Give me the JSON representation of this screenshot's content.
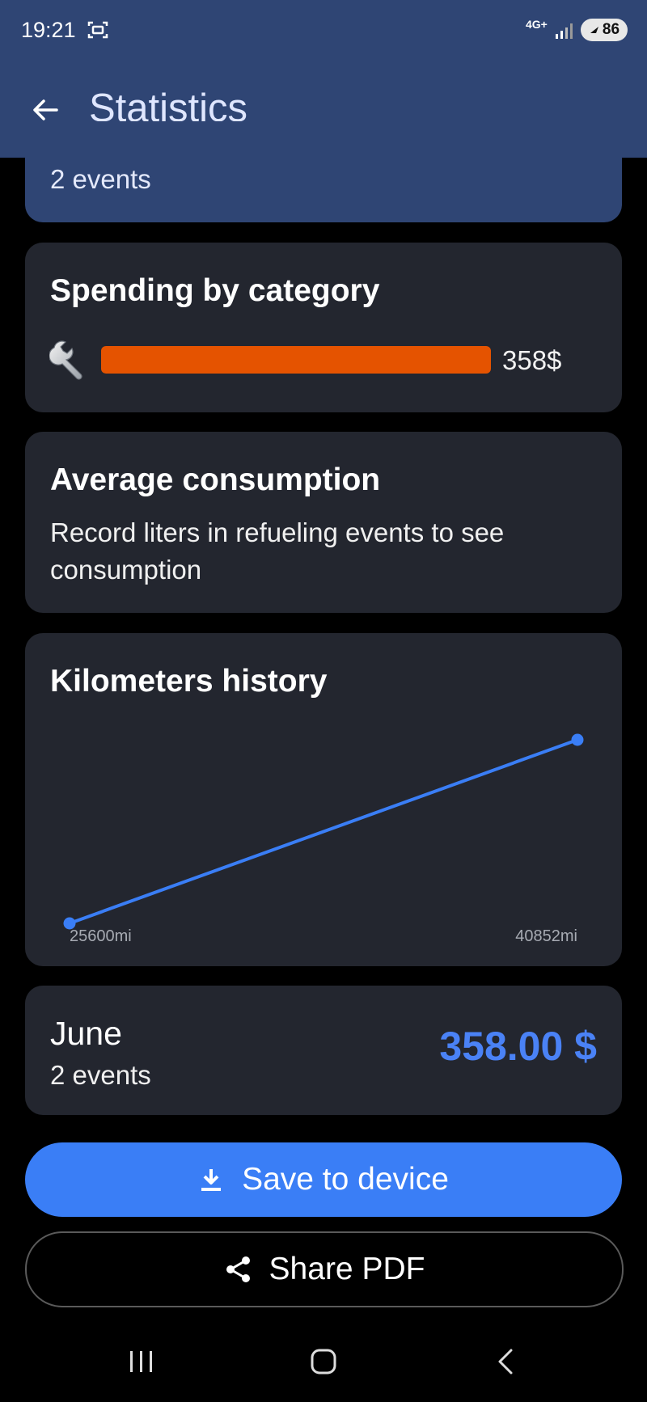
{
  "status_bar": {
    "time": "19:21",
    "network": "4G+",
    "battery": "86"
  },
  "header": {
    "title": "Statistics"
  },
  "summary": {
    "events": "2 events"
  },
  "spending": {
    "title": "Spending by category",
    "categories": [
      {
        "icon": "wrench-icon",
        "value": "358$",
        "fill_fraction": 1.0,
        "color": "#e55300"
      }
    ]
  },
  "consumption": {
    "title": "Average consumption",
    "message": "Record liters in refueling events to see consumption"
  },
  "km_history": {
    "title": "Kilometers history",
    "start_label": "25600mi",
    "end_label": "40852mi"
  },
  "chart_data": {
    "type": "line",
    "title": "Kilometers history",
    "series": [
      {
        "values": [
          25600,
          40852
        ]
      }
    ],
    "x_labels": [
      "25600mi",
      "40852mi"
    ],
    "color": "#3a7ef6"
  },
  "month": {
    "name": "June",
    "events": "2 events",
    "total": "358.00 $"
  },
  "actions": {
    "save_label": "Save to device",
    "share_label": "Share PDF"
  },
  "colors": {
    "accent": "#3a7ef6",
    "header": "#2f4574",
    "card": "#23262f",
    "category_bar": "#e55300"
  }
}
